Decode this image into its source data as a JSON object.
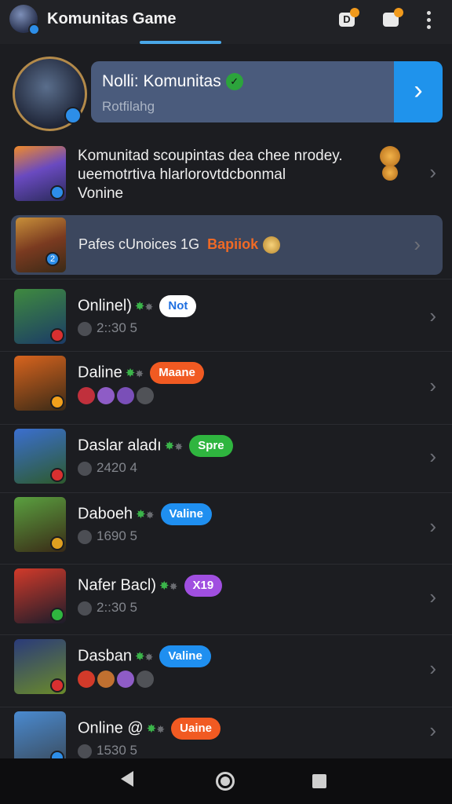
{
  "app": {
    "title": "Komunitas Game"
  },
  "topbar": {
    "icons": [
      "avatar-icon",
      "d-badge-icon",
      "chat-icon",
      "overflow-menu-icon"
    ],
    "d_glyph": "D"
  },
  "profile": {
    "name": "Nolli: Komunitas",
    "subtitle": "Rotfilahg",
    "verified_glyph": "✓",
    "go_glyph": "›"
  },
  "intro": {
    "line1": "Komunitad scoupintas dea chee nrodey.",
    "line2": "ueemotrtiva hlarlorovtdcbonmal",
    "line3": "Vonine"
  },
  "banner": {
    "text": "Pafes cUnoices 1G",
    "highlight": "Bapiiok",
    "mini_number": "2"
  },
  "items": [
    {
      "name": "Onlinel)",
      "badge": "Not",
      "badge_bg": "#ffffff",
      "badge_fg": "#1f6fe0",
      "meta": "2::30 5",
      "circles": [],
      "thumb_a": "#3f8a3f",
      "thumb_b": "#1b3b66",
      "mini": "#d93030"
    },
    {
      "name": "Daline",
      "badge": "Maane",
      "badge_bg": "#f15a22",
      "badge_fg": "#ffffff",
      "meta": "",
      "circles": [
        "#c0303c",
        "#8e5cc6",
        "#7a4fb8",
        "#505257"
      ],
      "thumb_a": "#d8641e",
      "thumb_b": "#3a2a16",
      "mini": "#f1a01c"
    },
    {
      "name": "Daslar aladı",
      "badge": "Spre",
      "badge_bg": "#2fb53f",
      "badge_fg": "#ffffff",
      "meta": "2420 4",
      "circles": [],
      "thumb_a": "#3b6fd0",
      "thumb_b": "#2d5a2d",
      "mini": "#d93030"
    },
    {
      "name": "Daboeh",
      "badge": "Valine",
      "badge_bg": "#1f8ff0",
      "badge_fg": "#ffffff",
      "meta": "1690 5",
      "circles": [],
      "thumb_a": "#5aa040",
      "thumb_b": "#3a2a16",
      "mini": "#e0a020"
    },
    {
      "name": "Nafer Bacl)",
      "badge": "X19",
      "badge_bg": "#a04fe0",
      "badge_fg": "#ffffff",
      "meta": "2::30 5",
      "circles": [],
      "thumb_a": "#d23a2a",
      "thumb_b": "#1c1c2a",
      "mini": "#2fb53f"
    },
    {
      "name": "Dasban",
      "badge": "Valine",
      "badge_bg": "#1f8ff0",
      "badge_fg": "#ffffff",
      "meta": "",
      "circles": [
        "#d23a2a",
        "#c07030",
        "#8e5cc6",
        "#505257"
      ],
      "thumb_a": "#2a3a7a",
      "thumb_b": "#6a8a2a",
      "mini": "#d93030"
    },
    {
      "name": "Online @",
      "badge": "Uaine",
      "badge_bg": "#f15a22",
      "badge_fg": "#ffffff",
      "meta": "1530 5",
      "circles": [],
      "thumb_a": "#4a8ad0",
      "thumb_b": "#3a4a5a",
      "mini": "#2d8ee8"
    }
  ],
  "navbar": {
    "icons": [
      "back-icon",
      "home-icon",
      "recents-icon"
    ]
  }
}
